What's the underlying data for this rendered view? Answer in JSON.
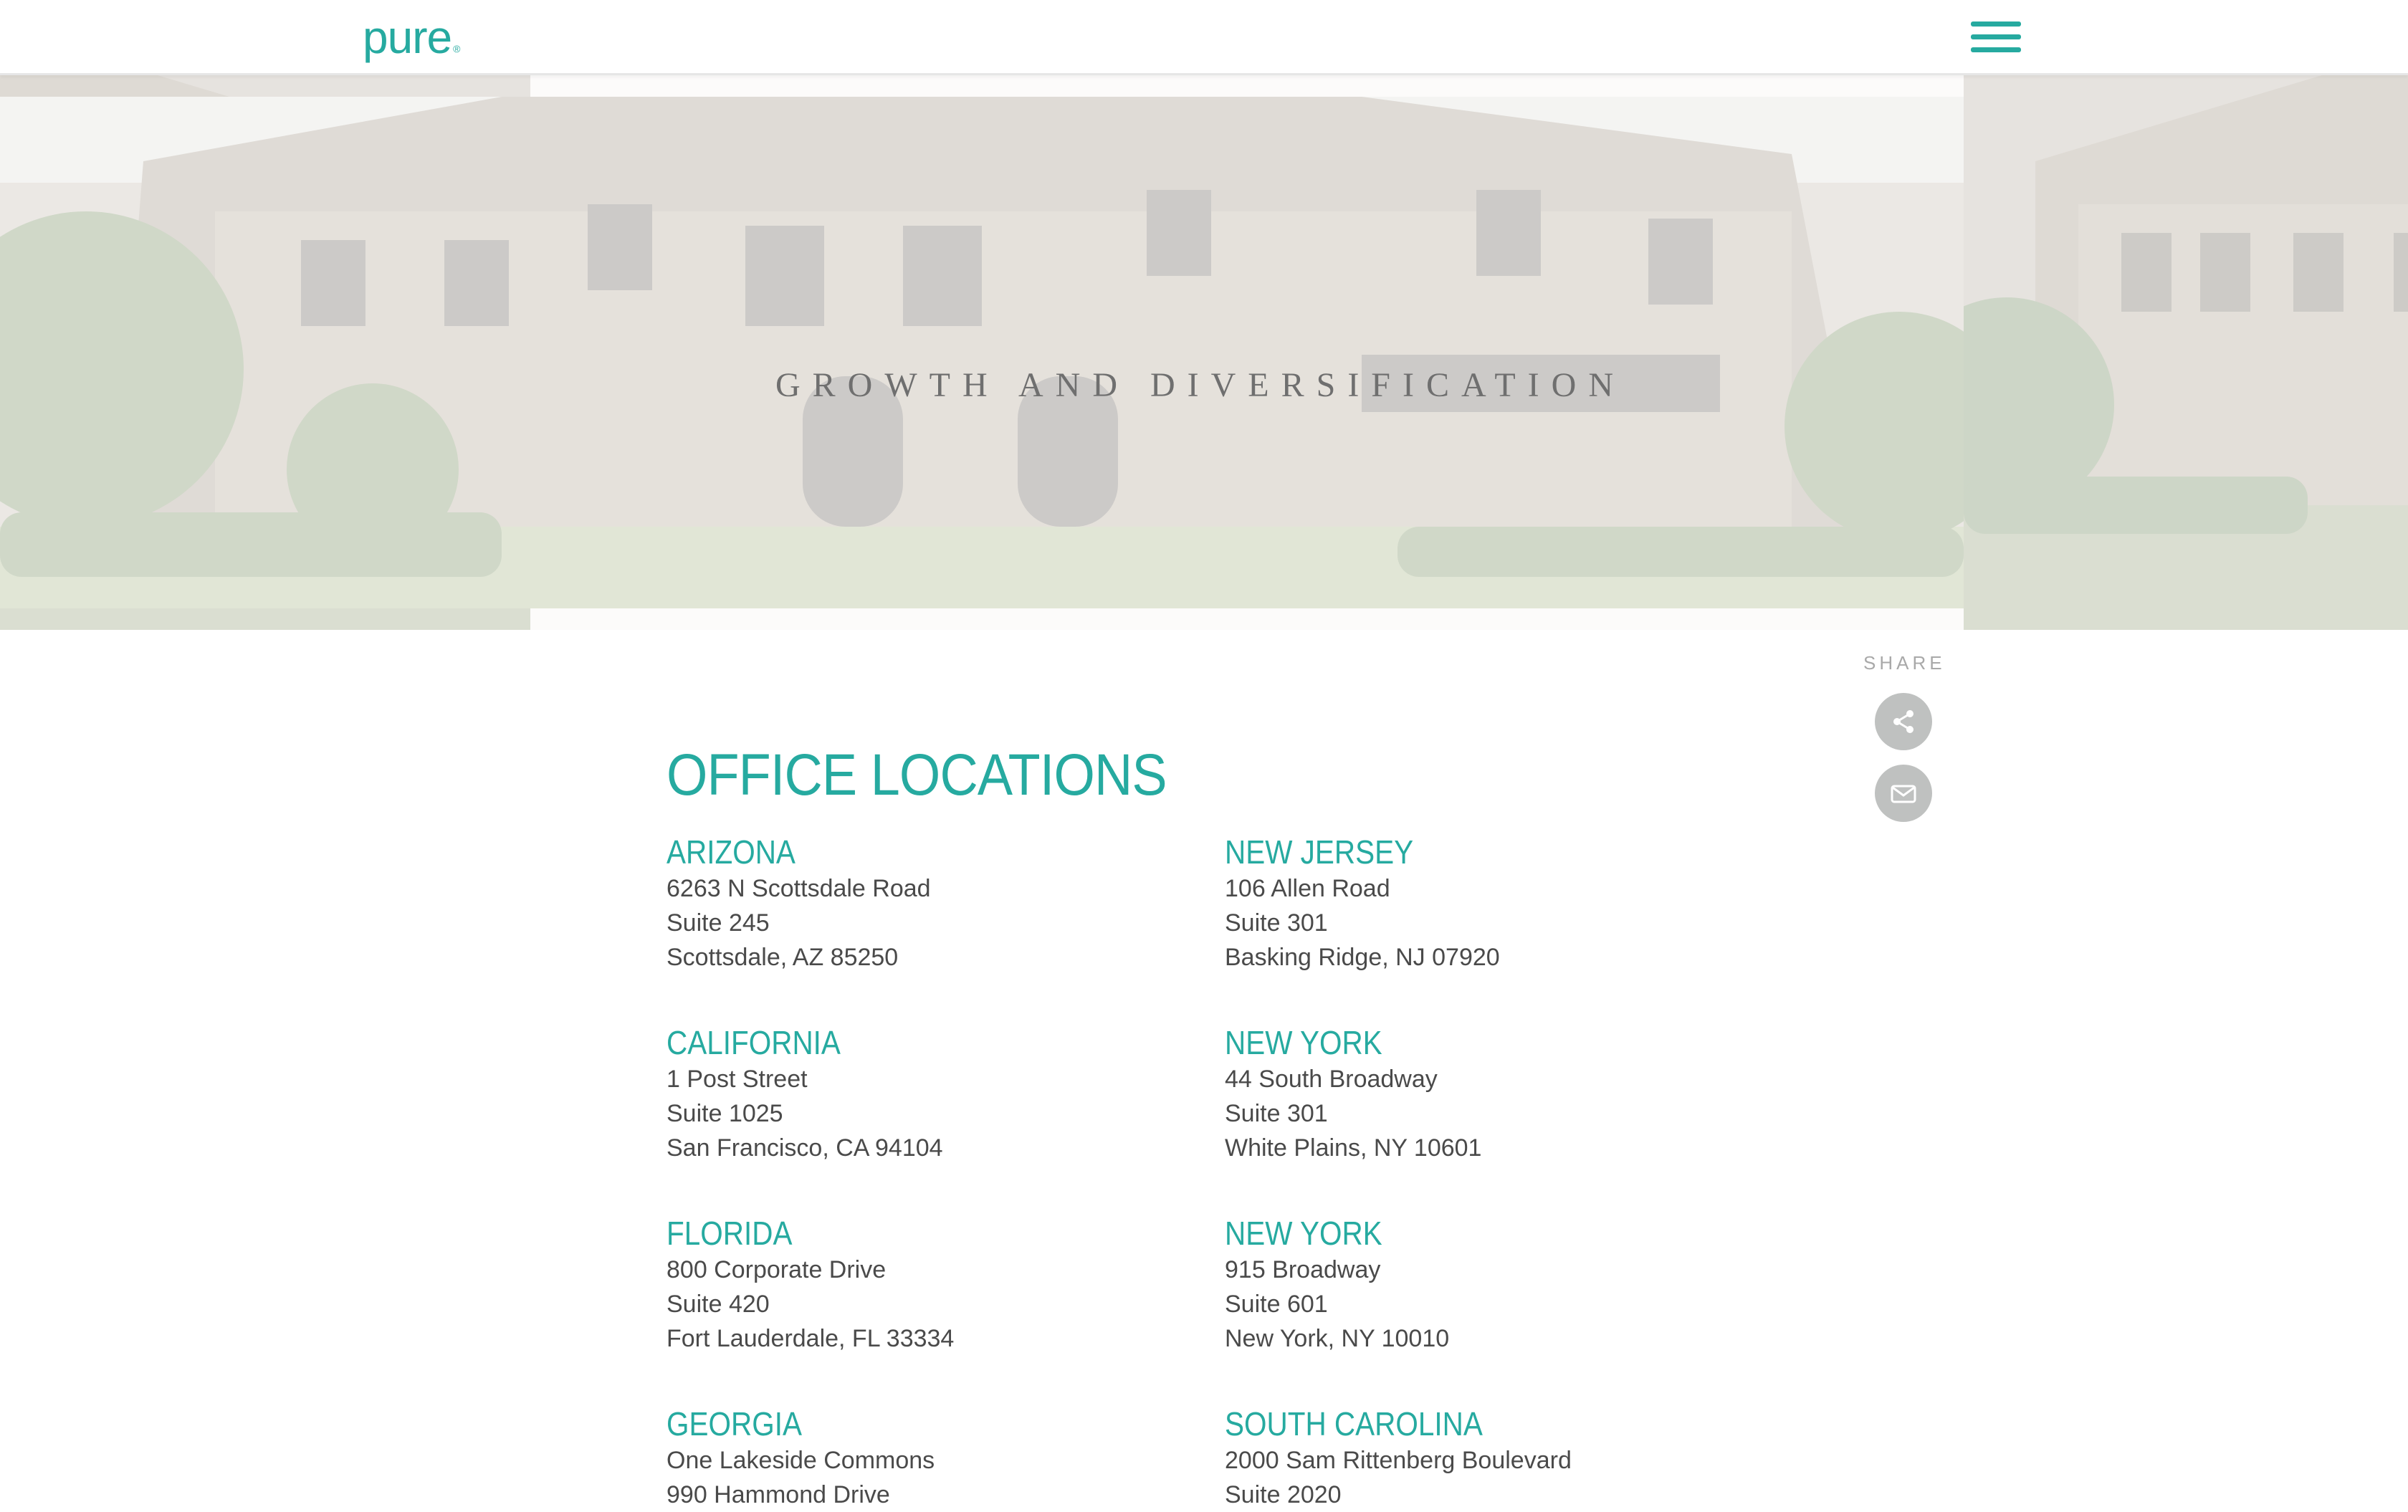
{
  "header": {
    "logo": "pure",
    "logo_mark": "®",
    "menu_icon": "hamburger-menu-icon"
  },
  "hero": {
    "title": "GROWTH AND DIVERSIFICATION"
  },
  "share": {
    "label": "SHARE",
    "share_icon": "share-icon",
    "email_icon": "envelope-icon"
  },
  "main": {
    "heading": "OFFICE LOCATIONS",
    "locations": [
      {
        "state": "ARIZONA",
        "lines": [
          "6263 N Scottsdale Road",
          "Suite 245",
          "Scottsdale, AZ 85250"
        ]
      },
      {
        "state": "NEW JERSEY",
        "lines": [
          "106 Allen Road",
          "Suite 301",
          "Basking Ridge, NJ 07920"
        ]
      },
      {
        "state": "CALIFORNIA",
        "lines": [
          "1 Post Street",
          "Suite 1025",
          "San Francisco, CA 94104"
        ]
      },
      {
        "state": "NEW YORK",
        "lines": [
          "44 South Broadway",
          "Suite 301",
          "White Plains, NY 10601"
        ]
      },
      {
        "state": "FLORIDA",
        "lines": [
          "800 Corporate Drive",
          "Suite 420",
          "Fort Lauderdale, FL 33334"
        ]
      },
      {
        "state": "NEW YORK",
        "lines": [
          "915 Broadway",
          "Suite 601",
          "New York, NY 10010"
        ]
      },
      {
        "state": "GEORGIA",
        "lines": [
          "One Lakeside Commons",
          "990 Hammond Drive"
        ]
      },
      {
        "state": "SOUTH CAROLINA",
        "lines": [
          "2000 Sam Rittenberg Boulevard",
          "Suite 2020"
        ]
      }
    ]
  },
  "colors": {
    "accent": "#26aaa0",
    "text": "#4a4a4a",
    "icon_button": "#bfc1c0"
  }
}
